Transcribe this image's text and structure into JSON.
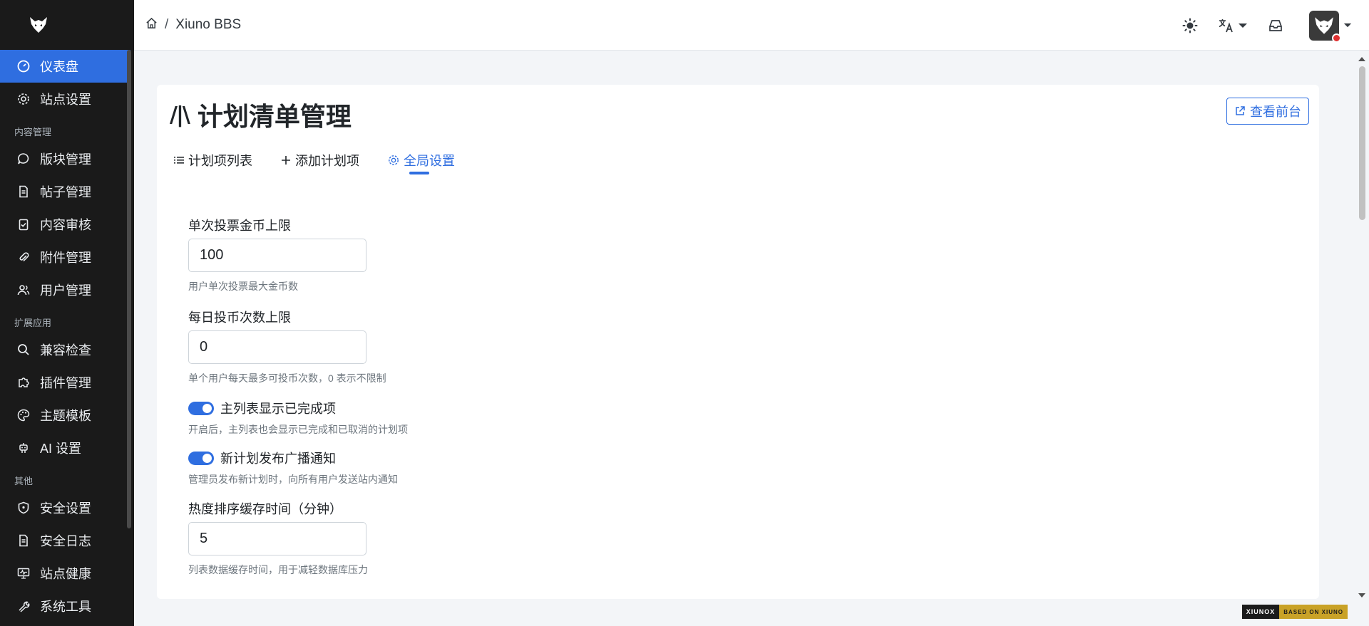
{
  "sidebar": {
    "items": [
      {
        "label": "仪表盘",
        "icon": "dashboard-icon",
        "active": true
      },
      {
        "label": "站点设置",
        "icon": "gear-icon"
      }
    ],
    "section_content": "内容管理",
    "content_items": [
      {
        "label": "版块管理",
        "icon": "chat-bubble-icon"
      },
      {
        "label": "帖子管理",
        "icon": "document-icon"
      },
      {
        "label": "内容审核",
        "icon": "clipboard-check-icon"
      },
      {
        "label": "附件管理",
        "icon": "paperclip-icon"
      },
      {
        "label": "用户管理",
        "icon": "users-icon"
      }
    ],
    "section_ext": "扩展应用",
    "ext_items": [
      {
        "label": "兼容检查",
        "icon": "search-icon"
      },
      {
        "label": "插件管理",
        "icon": "puzzle-icon"
      },
      {
        "label": "主题模板",
        "icon": "palette-icon"
      },
      {
        "label": "AI 设置",
        "icon": "robot-icon"
      }
    ],
    "section_other": "其他",
    "other_items": [
      {
        "label": "安全设置",
        "icon": "shield-icon"
      },
      {
        "label": "安全日志",
        "icon": "log-icon"
      },
      {
        "label": "站点健康",
        "icon": "monitor-icon"
      },
      {
        "label": "系统工具",
        "icon": "tools-icon"
      }
    ]
  },
  "topbar": {
    "breadcrumb_sep": "/",
    "site_name": "Xiuno BBS"
  },
  "page": {
    "title": "计划清单管理",
    "title_icon": "/|\\",
    "view_frontend": "查看前台",
    "tabs": [
      {
        "label": "计划项列表",
        "icon": "list-icon"
      },
      {
        "label": "添加计划项",
        "icon": "plus-icon"
      },
      {
        "label": "全局设置",
        "icon": "gear-icon",
        "active": true
      }
    ]
  },
  "form": {
    "vote_limit": {
      "label": "单次投票金币上限",
      "value": "100",
      "help": "用户单次投票最大金币数"
    },
    "daily_limit": {
      "label": "每日投币次数上限",
      "value": "0",
      "help": "单个用户每天最多可投币次数，0 表示不限制"
    },
    "show_completed": {
      "label": "主列表显示已完成项",
      "on": true,
      "help": "开启后，主列表也会显示已完成和已取消的计划项"
    },
    "broadcast": {
      "label": "新计划发布广播通知",
      "on": true,
      "help": "管理员发布新计划时，向所有用户发送站内通知"
    },
    "cache_time": {
      "label": "热度排序缓存时间（分钟）",
      "value": "5",
      "help": "列表数据缓存时间，用于减轻数据库压力"
    }
  },
  "badge": {
    "left": "XIUNOX",
    "right": "BASED ON XIUNO"
  },
  "colors": {
    "accent": "#2f6ee0",
    "sidebar_bg": "#1a1a1a"
  }
}
